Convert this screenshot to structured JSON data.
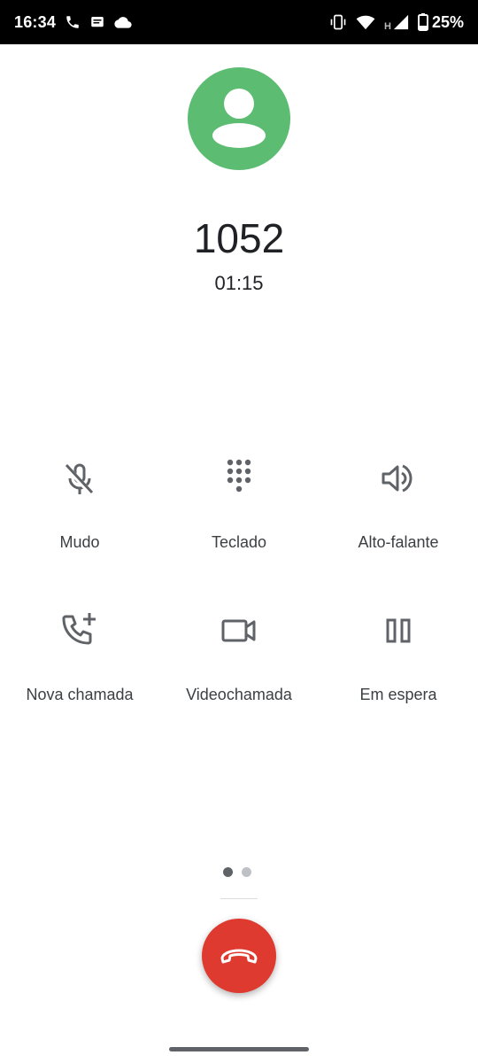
{
  "status_bar": {
    "time": "16:34",
    "battery_percent": "25%",
    "network_type": "H",
    "left_icons": [
      "phone-icon",
      "message-icon",
      "cloud-icon"
    ],
    "right_icons": [
      "vibrate-icon",
      "wifi-icon",
      "cellular-signal-icon",
      "battery-icon"
    ]
  },
  "call": {
    "number": "1052",
    "duration": "01:15"
  },
  "controls": [
    {
      "label": "Mudo",
      "icon": "mic-off-icon"
    },
    {
      "label": "Teclado",
      "icon": "dialpad-icon"
    },
    {
      "label": "Alto-falante",
      "icon": "speaker-icon"
    },
    {
      "label": "Nova chamada",
      "icon": "add-call-icon"
    },
    {
      "label": "Videochamada",
      "icon": "videocam-icon"
    },
    {
      "label": "Em espera",
      "icon": "pause-icon"
    }
  ],
  "page_indicator": {
    "pages": 2,
    "active": 1
  },
  "colors": {
    "avatar_bg": "#5bbc72",
    "end_call": "#de3a30",
    "icon": "#5f6368",
    "dot_active": "#5f6368",
    "dot_inactive": "#bdc1c6"
  }
}
